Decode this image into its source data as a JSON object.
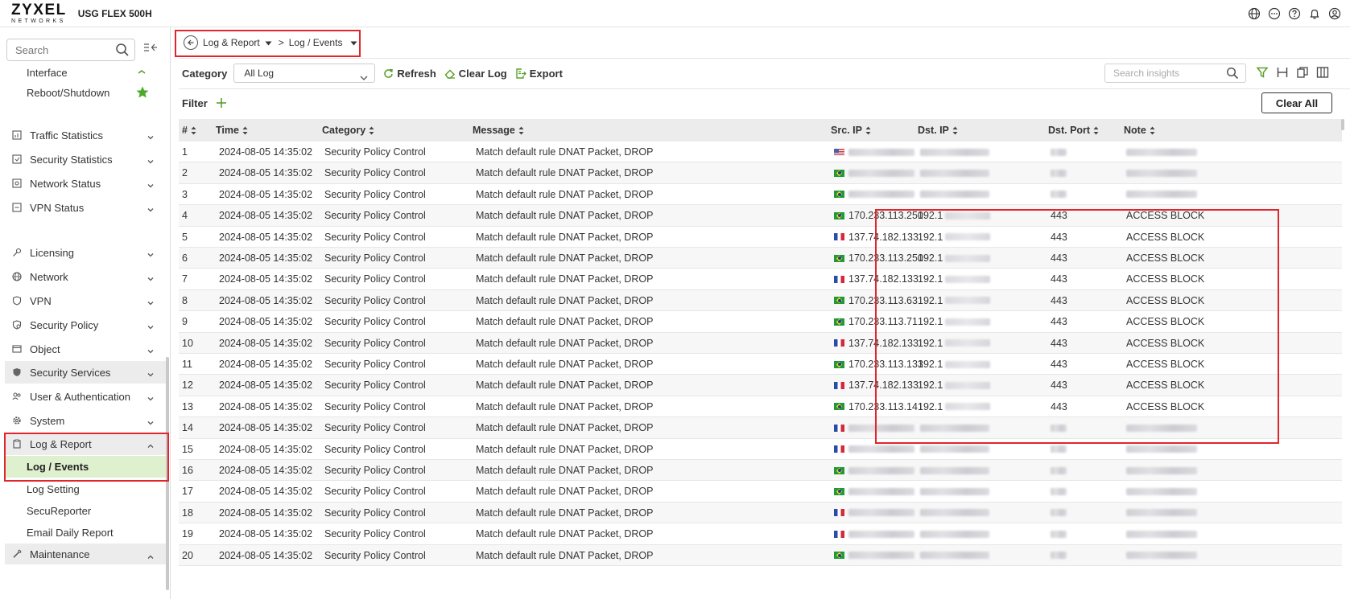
{
  "header": {
    "logo_main": "ZYXEL",
    "logo_sub": "NETWORKS",
    "model": "USG FLEX 500H",
    "icons": [
      "globe-icon",
      "chat-icon",
      "help-icon",
      "bell-icon",
      "user-icon"
    ]
  },
  "sidebar": {
    "search_placeholder": "Search",
    "top_items": [
      {
        "label": "Interface",
        "icon": "chevron-up-green"
      },
      {
        "label": "Reboot/Shutdown",
        "icon": "star-icon"
      }
    ],
    "sections": [
      {
        "label": "Traffic Statistics",
        "icon": "chart-icon"
      },
      {
        "label": "Security Statistics",
        "icon": "shield-chart-icon"
      },
      {
        "label": "Network Status",
        "icon": "network-icon"
      },
      {
        "label": "VPN Status",
        "icon": "vpn-icon"
      },
      {
        "label": "Licensing",
        "icon": "key-icon"
      },
      {
        "label": "Network",
        "icon": "globe-icon"
      },
      {
        "label": "VPN",
        "icon": "shield-icon"
      },
      {
        "label": "Security Policy",
        "icon": "policy-icon"
      },
      {
        "label": "Object",
        "icon": "box-icon"
      },
      {
        "label": "Security Services",
        "icon": "shield-check-icon"
      },
      {
        "label": "User & Authentication",
        "icon": "users-icon"
      },
      {
        "label": "System",
        "icon": "gear-icon"
      },
      {
        "label": "Log & Report",
        "icon": "clipboard-icon"
      },
      {
        "label": "Maintenance",
        "icon": "wrench-icon"
      }
    ],
    "log_sub": [
      "Log / Events",
      "Log Setting",
      "SecuReporter",
      "Email Daily Report"
    ]
  },
  "breadcrumb": {
    "first": "Log & Report",
    "sep": ">",
    "second": "Log / Events"
  },
  "toolbar": {
    "category_label": "Category",
    "category_value": "All Log",
    "refresh": "Refresh",
    "clear_log": "Clear Log",
    "export": "Export",
    "insights_placeholder": "Search insights"
  },
  "filter": {
    "label": "Filter",
    "clear_all": "Clear All"
  },
  "table": {
    "columns": [
      "#",
      "Time",
      "Category",
      "Message",
      "Src. IP",
      "Dst. IP",
      "Dst. Port",
      "Note"
    ],
    "rows": [
      {
        "n": "1",
        "time": "2024-08-05 14:35:02",
        "cat": "Security Policy Control",
        "msg": "Match default rule DNAT Packet, DROP",
        "flag": "us",
        "src": "",
        "dst": "",
        "port": "",
        "note": ""
      },
      {
        "n": "2",
        "time": "2024-08-05 14:35:02",
        "cat": "Security Policy Control",
        "msg": "Match default rule DNAT Packet, DROP",
        "flag": "br",
        "src": "",
        "dst": "",
        "port": "",
        "note": ""
      },
      {
        "n": "3",
        "time": "2024-08-05 14:35:02",
        "cat": "Security Policy Control",
        "msg": "Match default rule DNAT Packet, DROP",
        "flag": "br",
        "src": "",
        "dst": "",
        "port": "",
        "note": ""
      },
      {
        "n": "4",
        "time": "2024-08-05 14:35:02",
        "cat": "Security Policy Control",
        "msg": "Match default rule DNAT Packet, DROP",
        "flag": "br",
        "src": "170.233.113.250",
        "dst": "192.1",
        "port": "443",
        "note": "ACCESS BLOCK"
      },
      {
        "n": "5",
        "time": "2024-08-05 14:35:02",
        "cat": "Security Policy Control",
        "msg": "Match default rule DNAT Packet, DROP",
        "flag": "fr",
        "src": "137.74.182.133",
        "dst": "192.1",
        "port": "443",
        "note": "ACCESS BLOCK"
      },
      {
        "n": "6",
        "time": "2024-08-05 14:35:02",
        "cat": "Security Policy Control",
        "msg": "Match default rule DNAT Packet, DROP",
        "flag": "br",
        "src": "170.233.113.250",
        "dst": "192.1",
        "port": "443",
        "note": "ACCESS BLOCK"
      },
      {
        "n": "7",
        "time": "2024-08-05 14:35:02",
        "cat": "Security Policy Control",
        "msg": "Match default rule DNAT Packet, DROP",
        "flag": "fr",
        "src": "137.74.182.133",
        "dst": "192.1",
        "port": "443",
        "note": "ACCESS BLOCK"
      },
      {
        "n": "8",
        "time": "2024-08-05 14:35:02",
        "cat": "Security Policy Control",
        "msg": "Match default rule DNAT Packet, DROP",
        "flag": "br",
        "src": "170.233.113.63",
        "dst": "192.1",
        "port": "443",
        "note": "ACCESS BLOCK"
      },
      {
        "n": "9",
        "time": "2024-08-05 14:35:02",
        "cat": "Security Policy Control",
        "msg": "Match default rule DNAT Packet, DROP",
        "flag": "br",
        "src": "170.233.113.71",
        "dst": "192.1",
        "port": "443",
        "note": "ACCESS BLOCK"
      },
      {
        "n": "10",
        "time": "2024-08-05 14:35:02",
        "cat": "Security Policy Control",
        "msg": "Match default rule DNAT Packet, DROP",
        "flag": "fr",
        "src": "137.74.182.133",
        "dst": "192.1",
        "port": "443",
        "note": "ACCESS BLOCK"
      },
      {
        "n": "11",
        "time": "2024-08-05 14:35:02",
        "cat": "Security Policy Control",
        "msg": "Match default rule DNAT Packet, DROP",
        "flag": "br",
        "src": "170.233.113.133",
        "dst": "192.1",
        "port": "443",
        "note": "ACCESS BLOCK"
      },
      {
        "n": "12",
        "time": "2024-08-05 14:35:02",
        "cat": "Security Policy Control",
        "msg": "Match default rule DNAT Packet, DROP",
        "flag": "fr",
        "src": "137.74.182.133",
        "dst": "192.1",
        "port": "443",
        "note": "ACCESS BLOCK"
      },
      {
        "n": "13",
        "time": "2024-08-05 14:35:02",
        "cat": "Security Policy Control",
        "msg": "Match default rule DNAT Packet, DROP",
        "flag": "br",
        "src": "170.233.113.141",
        "dst": "192.1",
        "port": "443",
        "note": "ACCESS BLOCK"
      },
      {
        "n": "14",
        "time": "2024-08-05 14:35:02",
        "cat": "Security Policy Control",
        "msg": "Match default rule DNAT Packet, DROP",
        "flag": "fr",
        "src": "",
        "dst": "",
        "port": "",
        "note": ""
      },
      {
        "n": "15",
        "time": "2024-08-05 14:35:02",
        "cat": "Security Policy Control",
        "msg": "Match default rule DNAT Packet, DROP",
        "flag": "fr",
        "src": "",
        "dst": "",
        "port": "",
        "note": ""
      },
      {
        "n": "16",
        "time": "2024-08-05 14:35:02",
        "cat": "Security Policy Control",
        "msg": "Match default rule DNAT Packet, DROP",
        "flag": "br",
        "src": "",
        "dst": "",
        "port": "",
        "note": ""
      },
      {
        "n": "17",
        "time": "2024-08-05 14:35:02",
        "cat": "Security Policy Control",
        "msg": "Match default rule DNAT Packet, DROP",
        "flag": "br",
        "src": "",
        "dst": "",
        "port": "",
        "note": ""
      },
      {
        "n": "18",
        "time": "2024-08-05 14:35:02",
        "cat": "Security Policy Control",
        "msg": "Match default rule DNAT Packet, DROP",
        "flag": "fr",
        "src": "",
        "dst": "",
        "port": "",
        "note": ""
      },
      {
        "n": "19",
        "time": "2024-08-05 14:35:02",
        "cat": "Security Policy Control",
        "msg": "Match default rule DNAT Packet, DROP",
        "flag": "fr",
        "src": "",
        "dst": "",
        "port": "",
        "note": ""
      },
      {
        "n": "20",
        "time": "2024-08-05 14:35:02",
        "cat": "Security Policy Control",
        "msg": "Match default rule DNAT Packet, DROP",
        "flag": "br",
        "src": "",
        "dst": "",
        "port": "",
        "note": ""
      }
    ]
  },
  "colors": {
    "accent_green": "#5aa02c",
    "active_bg": "#dff0cf",
    "highlight_red": "#e0262c"
  }
}
